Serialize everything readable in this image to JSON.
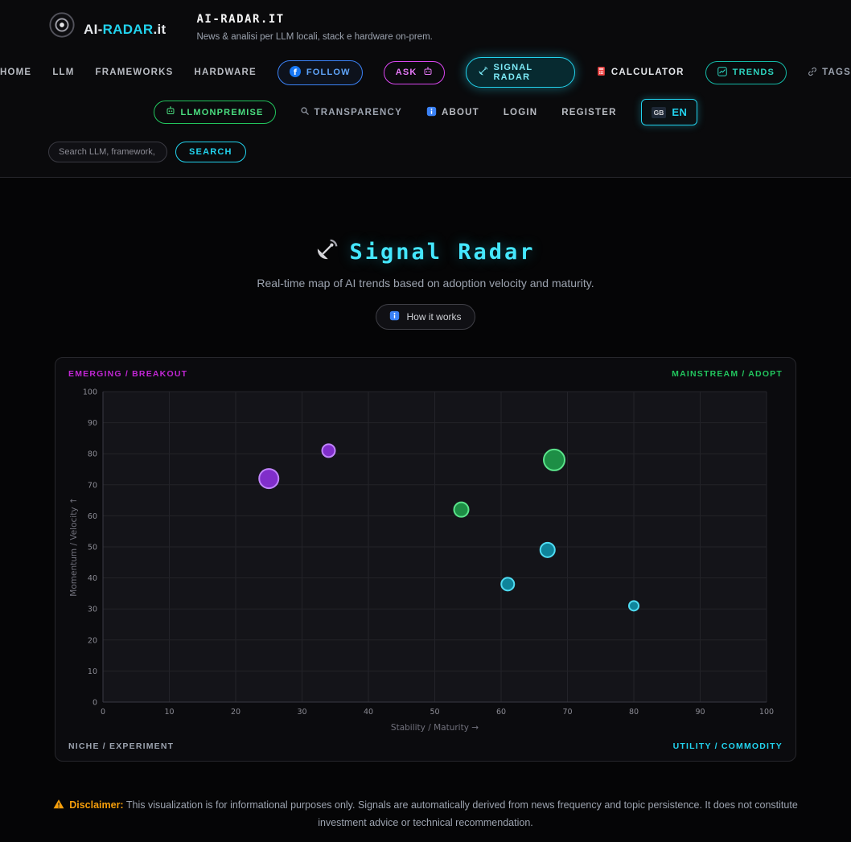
{
  "header": {
    "logo": {
      "part1": "AI-",
      "part2": "RADAR",
      "part3": ".it"
    },
    "site_title": "AI-RADAR.IT",
    "site_subtitle": "News & analisi per LLM locali, stack e hardware on-prem.",
    "nav_row1": {
      "home": "HOME",
      "llm": "LLM",
      "frameworks": "FRAMEWORKS",
      "hardware": "HARDWARE",
      "follow": "FOLLOW",
      "ask": "ASK",
      "signal_radar": "SIGNAL RADAR",
      "calculator": "CALCULATOR",
      "trends": "TRENDS",
      "tags": "TAGS"
    },
    "nav_row2": {
      "llmonpremise": "LLMONPREMISE",
      "transparency": "TRANSPARENCY",
      "about": "ABOUT",
      "login": "LOGIN",
      "register": "REGISTER",
      "lang_flag": "GB",
      "lang": "EN"
    },
    "search": {
      "placeholder": "Search LLM, framework, ha",
      "button": "SEARCH"
    }
  },
  "main": {
    "title": "Signal Radar",
    "subtitle": "Real-time map of AI trends based on adoption velocity and maturity.",
    "how_it_works": "How it works"
  },
  "chart_data": {
    "type": "scatter",
    "xlabel": "Stability / Maturity →",
    "ylabel": "Momentum / Velocity ↑",
    "xlim": [
      0,
      100
    ],
    "ylim": [
      0,
      100
    ],
    "x_ticks": [
      0,
      10,
      20,
      30,
      40,
      50,
      60,
      70,
      80,
      90,
      100
    ],
    "y_ticks": [
      0,
      10,
      20,
      30,
      40,
      50,
      60,
      70,
      80,
      90,
      100
    ],
    "grid": true,
    "legend": "none",
    "quadrant_labels": {
      "top_left": "EMERGING / BREAKOUT",
      "top_right": "MAINSTREAM / ADOPT",
      "bottom_left": "NICHE / EXPERIMENT",
      "bottom_right": "UTILITY / COMMODITY"
    },
    "quadrant_colors": {
      "top_left": "#c026d3",
      "top_right": "#22c55e",
      "bottom_left": "#9ca3af",
      "bottom_right": "#22d3ee"
    },
    "points": [
      {
        "x": 34,
        "y": 81,
        "r": 8,
        "fill": "#9333ea",
        "stroke": "#c084fc",
        "group": "emerging"
      },
      {
        "x": 25,
        "y": 72,
        "r": 12,
        "fill": "#9333ea",
        "stroke": "#c084fc",
        "group": "emerging"
      },
      {
        "x": 68,
        "y": 78,
        "r": 13,
        "fill": "#1ea34d",
        "stroke": "#5ae38a",
        "group": "mainstream"
      },
      {
        "x": 54,
        "y": 62,
        "r": 9,
        "fill": "#1ea34d",
        "stroke": "#5ae38a",
        "group": "mainstream"
      },
      {
        "x": 67,
        "y": 49,
        "r": 9,
        "fill": "#0e98b2",
        "stroke": "#4fdcf2",
        "group": "utility"
      },
      {
        "x": 61,
        "y": 38,
        "r": 8,
        "fill": "#0e98b2",
        "stroke": "#4fdcf2",
        "group": "utility"
      },
      {
        "x": 80,
        "y": 31,
        "r": 6,
        "fill": "#0e98b2",
        "stroke": "#4fdcf2",
        "group": "utility"
      }
    ]
  },
  "disclaimer": {
    "label": "Disclaimer:",
    "text": "This visualization is for informational purposes only. Signals are automatically derived from news frequency and topic persistence. It does not constitute investment advice or technical recommendation."
  }
}
